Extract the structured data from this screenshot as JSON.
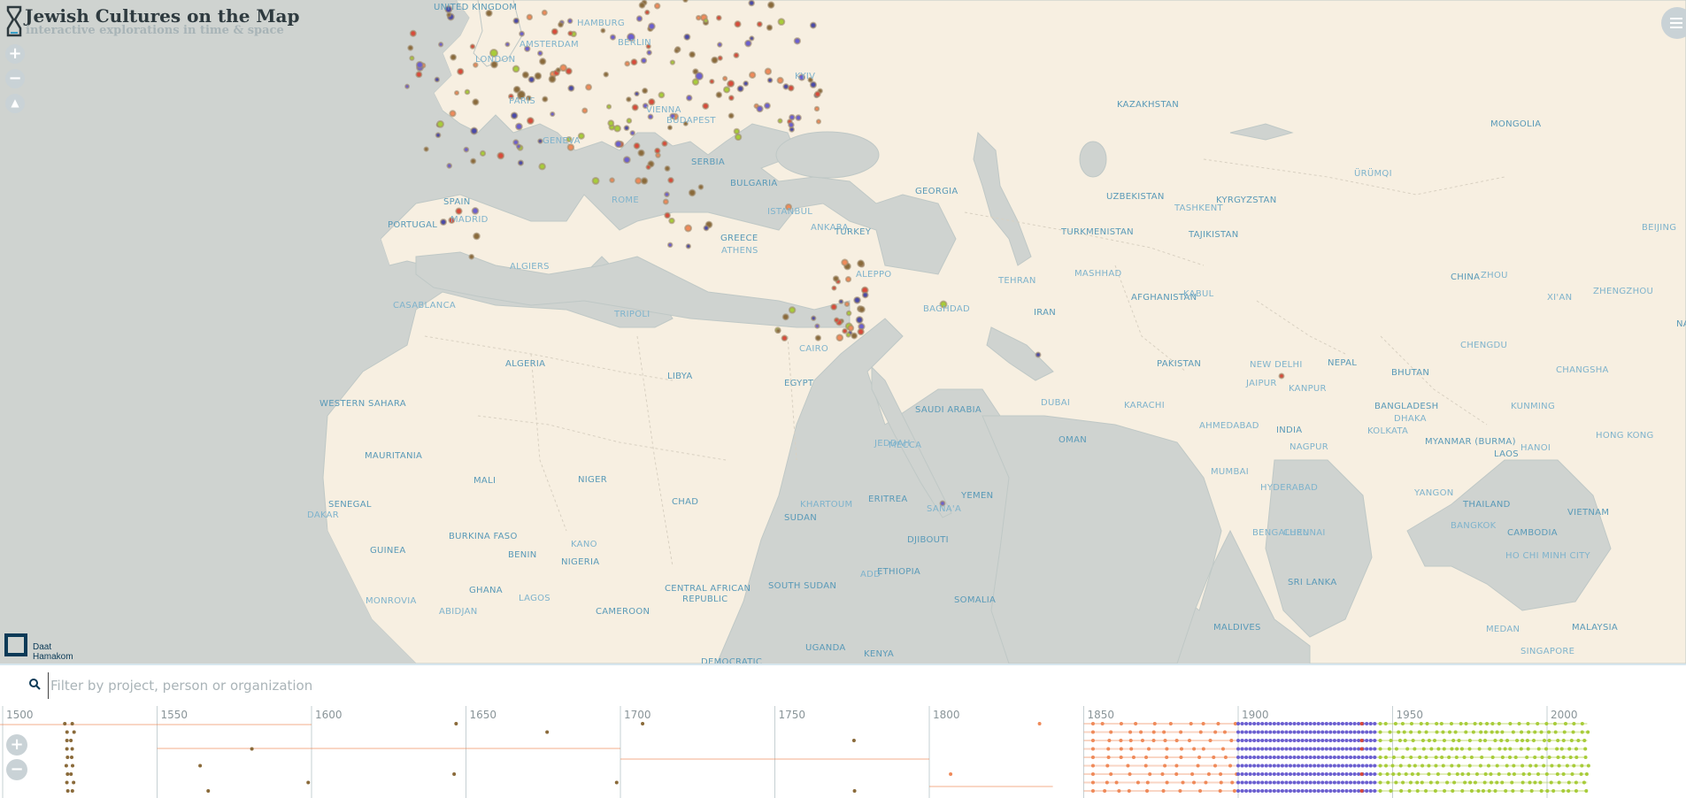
{
  "app": {
    "title": "Jewish Cultures on the Map",
    "subtitle": "interactive explorations in time & space",
    "partner_line1": "Daat",
    "partner_line2": "Hamakom"
  },
  "map_controls": {
    "zoom_in": "+",
    "zoom_out": "−",
    "reset_north": "▲",
    "icons": [
      "plus-icon",
      "minus-icon",
      "compass-icon",
      "menu-icon"
    ]
  },
  "colors": {
    "land": "#f7efe1",
    "water": "#cfd3d0",
    "label": "#5a9ab8",
    "dot_brown": "#8a6a3a",
    "dot_orange": "#ef8a5a",
    "dot_purple": "#6b5fd0",
    "dot_green": "#a8cc3a",
    "dot_red": "#d94a3a",
    "dot_blue": "#4a4aa8",
    "accent_dark": "#0b3a57"
  },
  "map_labels": [
    {
      "text": "UNITED KINGDOM"
    },
    {
      "text": "HAMBURG"
    },
    {
      "text": "AMSTERDAM"
    },
    {
      "text": "BERLIN"
    },
    {
      "text": "LONDON"
    },
    {
      "text": "PARIS"
    },
    {
      "text": "VIENNA"
    },
    {
      "text": "BUDAPEST"
    },
    {
      "text": "KYIV"
    },
    {
      "text": "GENEVA"
    },
    {
      "text": "SERBIA"
    },
    {
      "text": "BULGARIA"
    },
    {
      "text": "ROME"
    },
    {
      "text": "ISTANBUL"
    },
    {
      "text": "ANKARA"
    },
    {
      "text": "TURKEY"
    },
    {
      "text": "GREECE"
    },
    {
      "text": "ATHENS"
    },
    {
      "text": "SPAIN"
    },
    {
      "text": "MADRID"
    },
    {
      "text": "PORTUGAL"
    },
    {
      "text": "ALGIERS"
    },
    {
      "text": "CASABLANCA"
    },
    {
      "text": "TRIPOLI"
    },
    {
      "text": "ALEPPO"
    },
    {
      "text": "BAGHDAD"
    },
    {
      "text": "CAIRO"
    },
    {
      "text": "ALGERIA"
    },
    {
      "text": "LIBYA"
    },
    {
      "text": "EGYPT"
    },
    {
      "text": "WESTERN SAHARA"
    },
    {
      "text": "MAURITANIA"
    },
    {
      "text": "MALI"
    },
    {
      "text": "NIGER"
    },
    {
      "text": "CHAD"
    },
    {
      "text": "KHARTOUM"
    },
    {
      "text": "SUDAN"
    },
    {
      "text": "ERITREA"
    },
    {
      "text": "SANA'A"
    },
    {
      "text": "YEMEN"
    },
    {
      "text": "DJIBOUTI"
    },
    {
      "text": "ETHIOPIA"
    },
    {
      "text": "ADD"
    },
    {
      "text": "SOMALIA"
    },
    {
      "text": "SOUTH SUDAN"
    },
    {
      "text": "CENTRAL AFRICAN"
    },
    {
      "text": "REPUBLIC"
    },
    {
      "text": "CAMEROON"
    },
    {
      "text": "NIGERIA"
    },
    {
      "text": "KANO"
    },
    {
      "text": "BENIN"
    },
    {
      "text": "GHANA"
    },
    {
      "text": "LAGOS"
    },
    {
      "text": "ABIDJAN"
    },
    {
      "text": "MONROVIA"
    },
    {
      "text": "GUINEA"
    },
    {
      "text": "BURKINA FASO"
    },
    {
      "text": "SENEGAL"
    },
    {
      "text": "DAKAR"
    },
    {
      "text": "UGANDA"
    },
    {
      "text": "KENYA"
    },
    {
      "text": "DEMOCRATIC"
    },
    {
      "text": "SAUDI ARABIA"
    },
    {
      "text": "JEDDAH"
    },
    {
      "text": "MECCA"
    },
    {
      "text": "DUBAI"
    },
    {
      "text": "OMAN"
    },
    {
      "text": "IRAN"
    },
    {
      "text": "TEHRAN"
    },
    {
      "text": "MASHHAD"
    },
    {
      "text": "GEORGIA"
    },
    {
      "text": "KAZAKHSTAN"
    },
    {
      "text": "UZBEKISTAN"
    },
    {
      "text": "TURKMENISTAN"
    },
    {
      "text": "TASHKENT"
    },
    {
      "text": "KYRGYZSTAN"
    },
    {
      "text": "TAJIKISTAN"
    },
    {
      "text": "AFGHANISTAN"
    },
    {
      "text": "KABUL"
    },
    {
      "text": "PAKISTAN"
    },
    {
      "text": "KARACHI"
    },
    {
      "text": "NEW DELHI"
    },
    {
      "text": "JAIPUR"
    },
    {
      "text": "KANPUR"
    },
    {
      "text": "NEPAL"
    },
    {
      "text": "BHUTAN"
    },
    {
      "text": "INDIA"
    },
    {
      "text": "AHMEDABAD"
    },
    {
      "text": "NAGPUR"
    },
    {
      "text": "MUMBAI"
    },
    {
      "text": "HYDERABAD"
    },
    {
      "text": "BENGALURU"
    },
    {
      "text": "CHENNAI"
    },
    {
      "text": "SRI LANKA"
    },
    {
      "text": "MALDIVES"
    },
    {
      "text": "BANGLADESH"
    },
    {
      "text": "DHAKA"
    },
    {
      "text": "KOLKATA"
    },
    {
      "text": "MYANMAR (BURMA)"
    },
    {
      "text": "YANGON"
    },
    {
      "text": "THAILAND"
    },
    {
      "text": "BANGKOK"
    },
    {
      "text": "LAOS"
    },
    {
      "text": "HANOI"
    },
    {
      "text": "VIETNAM"
    },
    {
      "text": "CAMBODIA"
    },
    {
      "text": "HO CHI MINH CITY"
    },
    {
      "text": "MALAYSIA"
    },
    {
      "text": "MEDAN"
    },
    {
      "text": "SINGAPORE"
    },
    {
      "text": "KUNMING"
    },
    {
      "text": "HONG KONG"
    },
    {
      "text": "CHINA"
    },
    {
      "text": "CHENGDU"
    },
    {
      "text": "CHANGSHA"
    },
    {
      "text": "ZHENGZHOU"
    },
    {
      "text": "XI'AN"
    },
    {
      "text": "ZHOU"
    },
    {
      "text": "BEIJING"
    },
    {
      "text": "MONGOLIA"
    },
    {
      "text": "ÜRÜMQI"
    },
    {
      "text": "NA"
    }
  ],
  "search": {
    "placeholder": "Filter by project, person or organization",
    "value": ""
  },
  "timeline": {
    "ticks": [
      "1500",
      "1550",
      "1600",
      "1650",
      "1700",
      "1750",
      "1800",
      "1850",
      "1900",
      "1950",
      "2000"
    ],
    "zoom_in": "+",
    "zoom_out": "−"
  }
}
